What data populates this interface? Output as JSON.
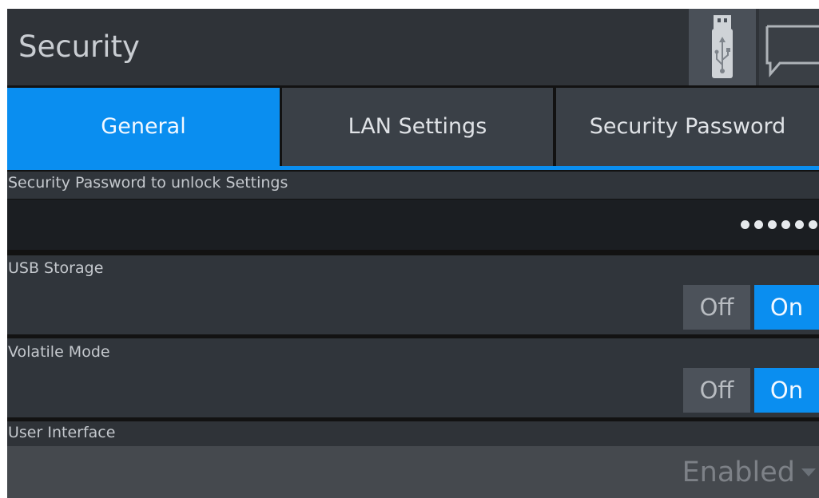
{
  "header": {
    "title": "Security",
    "icons": [
      "usb-icon",
      "message-icon"
    ]
  },
  "tabs": [
    {
      "label": "General",
      "active": true
    },
    {
      "label": "LAN Settings",
      "active": false
    },
    {
      "label": "Security Password",
      "active": false
    }
  ],
  "settings": {
    "password": {
      "label": "Security Password to unlock Settings",
      "masked_length": 6
    },
    "usb_storage": {
      "label": "USB Storage",
      "options": [
        "Off",
        "On"
      ],
      "selected": "On"
    },
    "volatile_mode": {
      "label": "Volatile Mode",
      "options": [
        "Off",
        "On"
      ],
      "selected": "On"
    },
    "user_interface": {
      "label": "User Interface",
      "value": "Enabled"
    }
  },
  "colors": {
    "accent": "#0a8ef0",
    "panel": "#30353b",
    "header": "#2f3338"
  }
}
